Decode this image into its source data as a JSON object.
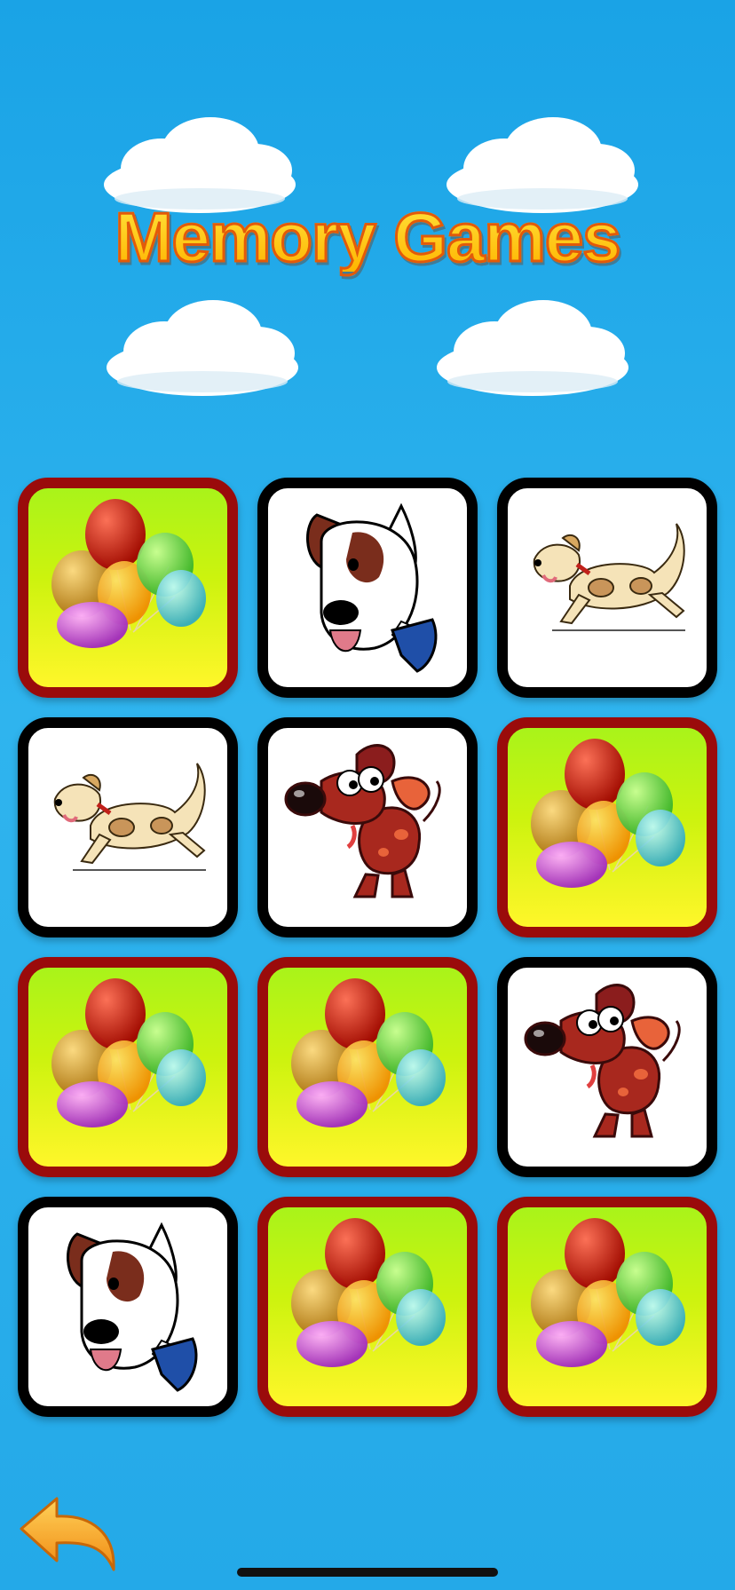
{
  "title": "Memory Games",
  "colors": {
    "sky": "#24a9e8",
    "title_fill": "#ffd21f",
    "title_outline": "#e25a0a",
    "card_back_border": "#9a0b0b",
    "card_face_border": "#000000",
    "back_arrow": "#f7941d"
  },
  "board": {
    "rows": 4,
    "columns": 3,
    "cards": [
      {
        "state": "hidden",
        "image": "balloons-icon"
      },
      {
        "state": "revealed",
        "image": "spotted-dog-head-icon"
      },
      {
        "state": "revealed",
        "image": "running-puppy-icon"
      },
      {
        "state": "revealed",
        "image": "running-puppy-icon"
      },
      {
        "state": "revealed",
        "image": "cartoon-brown-dog-icon"
      },
      {
        "state": "hidden",
        "image": "balloons-icon"
      },
      {
        "state": "hidden",
        "image": "balloons-icon"
      },
      {
        "state": "hidden",
        "image": "balloons-icon"
      },
      {
        "state": "revealed",
        "image": "cartoon-brown-dog-icon"
      },
      {
        "state": "revealed",
        "image": "spotted-dog-head-icon"
      },
      {
        "state": "hidden",
        "image": "balloons-icon"
      },
      {
        "state": "hidden",
        "image": "balloons-icon"
      }
    ]
  },
  "navigation": {
    "back_icon": "back-arrow-icon"
  }
}
